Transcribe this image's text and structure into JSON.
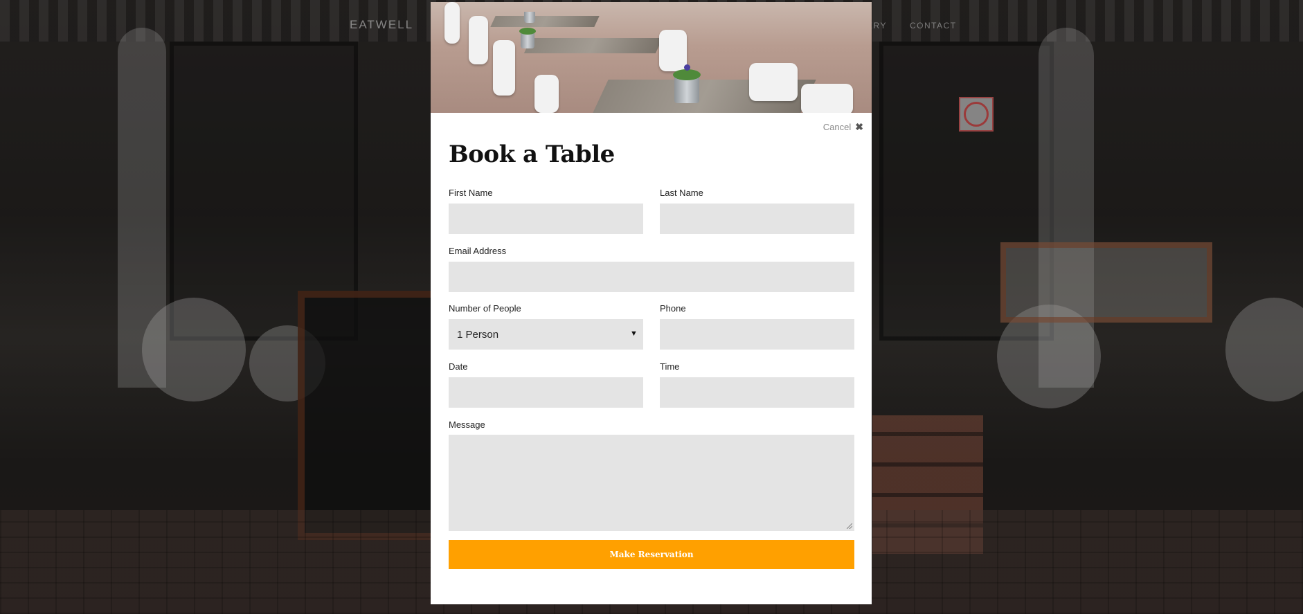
{
  "nav": {
    "brand": "EATWELL",
    "links": [
      "ERY",
      "CONTACT"
    ]
  },
  "modal": {
    "cancel_label": "Cancel",
    "close_glyph": "✖",
    "title": "Book a Table",
    "fields": {
      "first_name": {
        "label": "First Name",
        "value": ""
      },
      "last_name": {
        "label": "Last Name",
        "value": ""
      },
      "email": {
        "label": "Email Address",
        "value": ""
      },
      "people": {
        "label": "Number of People",
        "selected": "1 Person"
      },
      "phone": {
        "label": "Phone",
        "value": ""
      },
      "date": {
        "label": "Date",
        "value": ""
      },
      "time": {
        "label": "Time",
        "value": ""
      },
      "message": {
        "label": "Message",
        "value": ""
      }
    },
    "submit_label": "Make Reservation"
  },
  "icons": {
    "close": "close-icon",
    "dropdown": "chevron-down-icon"
  },
  "colors": {
    "accent": "#ffa000",
    "field_bg": "#e4e4e4",
    "modal_bg": "#ffffff"
  }
}
